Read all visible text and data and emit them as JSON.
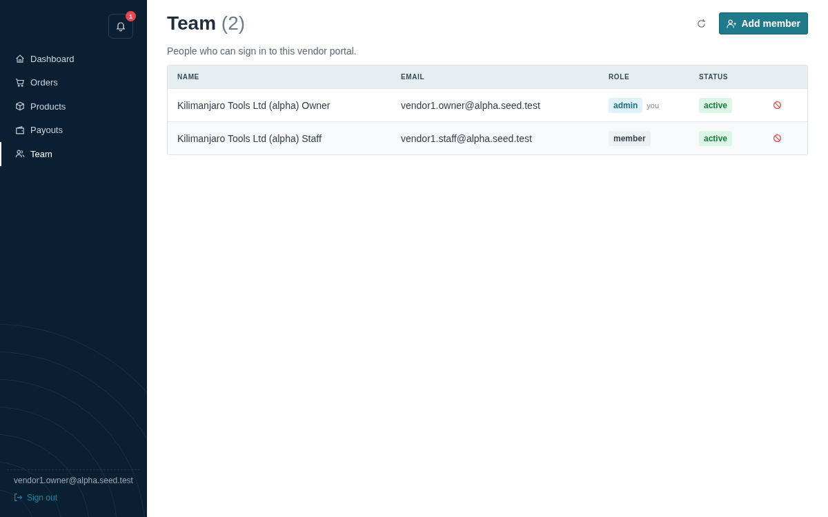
{
  "sidebar": {
    "notifications": {
      "count": "1"
    },
    "items": [
      {
        "label": "Dashboard",
        "selected": false
      },
      {
        "label": "Orders",
        "selected": false
      },
      {
        "label": "Products",
        "selected": false
      },
      {
        "label": "Payouts",
        "selected": false
      },
      {
        "label": "Team",
        "selected": true
      }
    ],
    "user_email": "vendor1.owner@alpha.seed.test",
    "sign_out": "Sign out"
  },
  "header": {
    "title": "Team",
    "count": "(2)",
    "subtitle": "People who can sign in to this vendor portal.",
    "add_button": "Add member"
  },
  "table": {
    "columns": [
      "NAME",
      "EMAIL",
      "ROLE",
      "STATUS"
    ],
    "rows": [
      {
        "name": "Kilimanjaro Tools Ltd (alpha) Owner",
        "email": "vendor1.owner@alpha.seed.test",
        "role": {
          "label": "admin",
          "kind": "admin"
        },
        "note": "you",
        "status": "active"
      },
      {
        "name": "Kilimanjaro Tools Ltd (alpha) Staff",
        "email": "vendor1.staff@alpha.seed.test",
        "role": {
          "label": "member",
          "kind": "member"
        },
        "status": "active"
      }
    ]
  }
}
